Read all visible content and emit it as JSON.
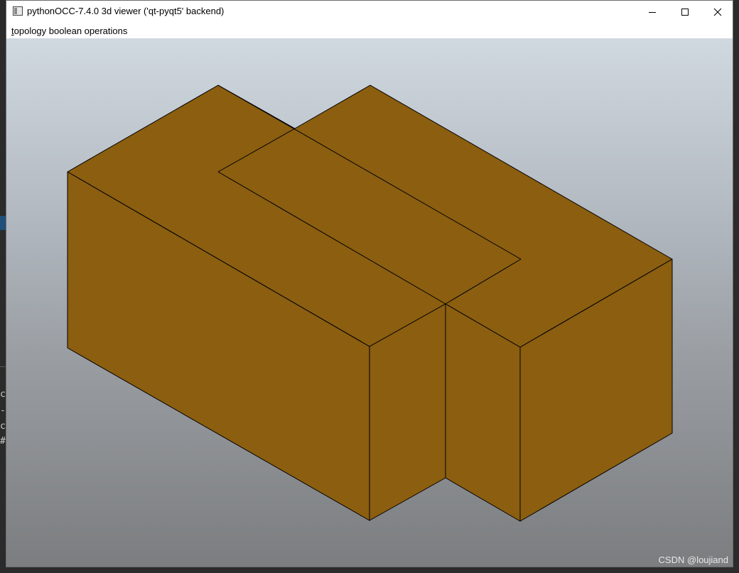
{
  "window": {
    "title": "pythonOCC-7.4.0 3d viewer ('qt-pyqt5' backend)",
    "controls": {
      "minimize_icon": "minimize-icon",
      "maximize_icon": "maximize-icon",
      "close_icon": "close-icon"
    }
  },
  "menubar": {
    "items": [
      {
        "mnemonic": "t",
        "rest": "opology boolean operations"
      }
    ]
  },
  "viewport": {
    "shape_color": "#8B5E10",
    "edge_color": "#000000",
    "background_top": "#d0d8e0",
    "background_bottom": "#7b7d7f"
  },
  "background_ide": {
    "fragments": [
      "c",
      "-[",
      "cc",
      "#"
    ]
  },
  "watermark": "CSDN @loujiand"
}
